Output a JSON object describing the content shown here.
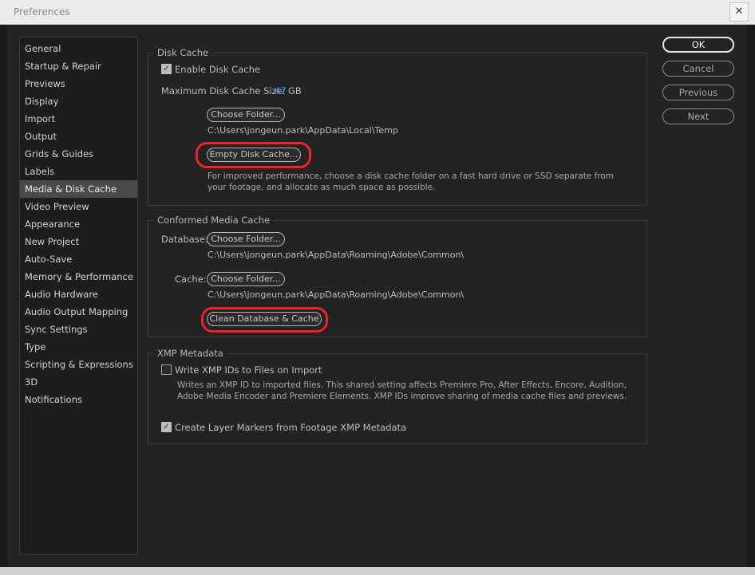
{
  "window": {
    "title": "Preferences",
    "close_glyph": "✕"
  },
  "sidebar": {
    "items": [
      {
        "label": "General"
      },
      {
        "label": "Startup & Repair"
      },
      {
        "label": "Previews"
      },
      {
        "label": "Display"
      },
      {
        "label": "Import"
      },
      {
        "label": "Output"
      },
      {
        "label": "Grids & Guides"
      },
      {
        "label": "Labels"
      },
      {
        "label": "Media & Disk Cache",
        "selected": true
      },
      {
        "label": "Video Preview"
      },
      {
        "label": "Appearance"
      },
      {
        "label": "New Project"
      },
      {
        "label": "Auto-Save"
      },
      {
        "label": "Memory & Performance"
      },
      {
        "label": "Audio Hardware"
      },
      {
        "label": "Audio Output Mapping"
      },
      {
        "label": "Sync Settings"
      },
      {
        "label": "Type"
      },
      {
        "label": "Scripting & Expressions"
      },
      {
        "label": "3D"
      },
      {
        "label": "Notifications"
      }
    ]
  },
  "disk_cache": {
    "legend": "Disk Cache",
    "enable_label": "Enable Disk Cache",
    "enable_checked": true,
    "max_size_label": "Maximum Disk Cache Size:",
    "max_size_value": "47",
    "max_size_unit": "GB",
    "choose_folder": "Choose Folder...",
    "path": "C:\\Users\\jongeun.park\\AppData\\Local\\Temp",
    "empty_cache": "Empty Disk Cache...",
    "note": "For improved performance, choose a disk cache folder on a fast hard drive or SSD separate from your footage, and allocate as much space as possible."
  },
  "conformed": {
    "legend": "Conformed Media Cache",
    "database_label": "Database:",
    "database_button": "Choose Folder...",
    "database_path": "C:\\Users\\jongeun.park\\AppData\\Roaming\\Adobe\\Common\\",
    "cache_label": "Cache:",
    "cache_button": "Choose Folder...",
    "cache_path": "C:\\Users\\jongeun.park\\AppData\\Roaming\\Adobe\\Common\\",
    "clean_button": "Clean Database & Cache"
  },
  "xmp": {
    "legend": "XMP Metadata",
    "write_label": "Write XMP IDs to Files on Import",
    "write_checked": false,
    "write_note": "Writes an XMP ID to imported files. This shared setting affects Premiere Pro, After Effects, Encore, Audition, Adobe Media Encoder and Premiere Elements. XMP IDs improve sharing of media cache files and previews.",
    "markers_label": "Create Layer Markers from Footage XMP Metadata",
    "markers_checked": true
  },
  "buttons": {
    "ok": "OK",
    "cancel": "Cancel",
    "previous": "Previous",
    "next": "Next"
  },
  "glyphs": {
    "check": "✓"
  },
  "colors": {
    "highlight_ring": "#e8232b",
    "link_value": "#4a9df0"
  }
}
